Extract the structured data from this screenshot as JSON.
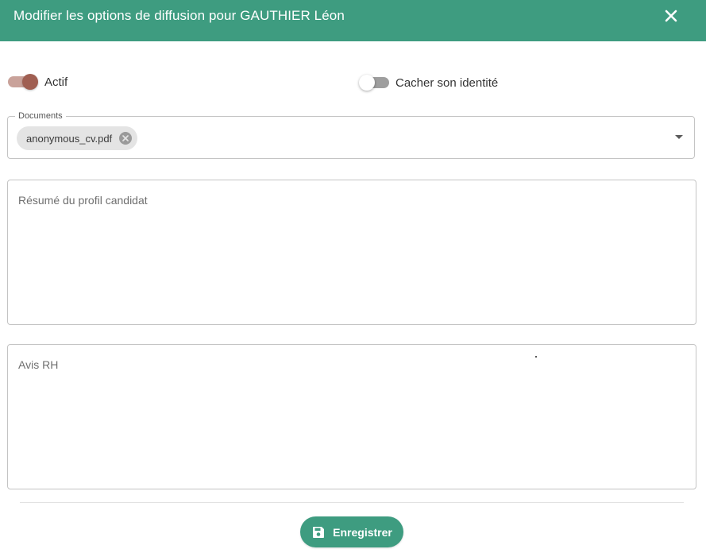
{
  "dialog": {
    "title": "Modifier les options de diffusion pour GAUTHIER Léon",
    "close_icon": "close-icon"
  },
  "toggles": {
    "actif": {
      "label": "Actif",
      "checked": true
    },
    "cacher_identite": {
      "label": "Cacher son identité",
      "checked": false
    }
  },
  "documents": {
    "label": "Documents",
    "selected": [
      {
        "label": "anonymous_cv.pdf"
      }
    ]
  },
  "fields": {
    "resume": {
      "placeholder": "Résumé du profil candidat",
      "value": ""
    },
    "avis_rh": {
      "placeholder": "Avis RH",
      "value": ""
    }
  },
  "footer": {
    "save_label": "Enregistrer",
    "save_icon": "save-icon"
  },
  "colors": {
    "header": "#3e9c80",
    "accent": "#a05f52",
    "button": "#3e9c80"
  }
}
